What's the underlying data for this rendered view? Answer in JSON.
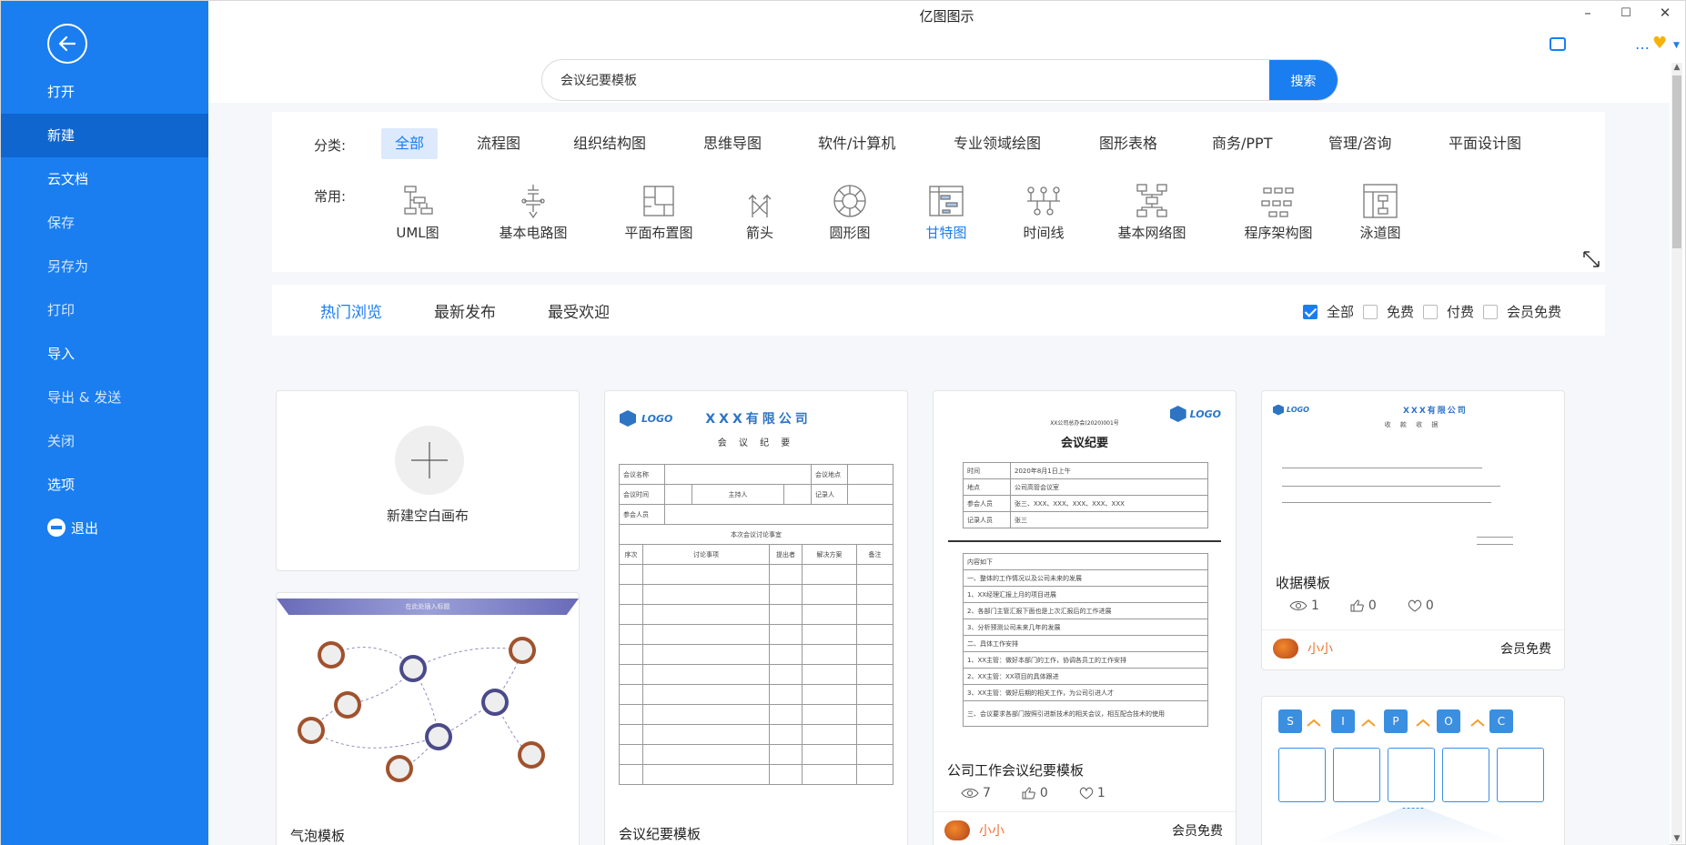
{
  "window": {
    "title": "亿图图示",
    "min": "–",
    "max": "☐",
    "close": "✕"
  },
  "sidebar": {
    "items": [
      {
        "label": "打开"
      },
      {
        "label": "新建"
      },
      {
        "label": "云文档"
      },
      {
        "label": "保存"
      },
      {
        "label": "另存为"
      },
      {
        "label": "打印"
      },
      {
        "label": "导入"
      },
      {
        "label": "导出 & 发送"
      },
      {
        "label": "关闭"
      },
      {
        "label": "选项"
      },
      {
        "label": "退出"
      }
    ]
  },
  "search": {
    "value": "会议纪要模板",
    "button": "搜索"
  },
  "categories": {
    "label": "分类:",
    "items": [
      "全部",
      "流程图",
      "组织结构图",
      "思维导图",
      "软件/计算机",
      "专业领域绘图",
      "图形表格",
      "商务/PPT",
      "管理/咨询",
      "平面设计图"
    ]
  },
  "common": {
    "label": "常用:",
    "items": [
      "UML图",
      "基本电路图",
      "平面布置图",
      "箭头",
      "圆形图",
      "甘特图",
      "时间线",
      "基本网络图",
      "程序架构图",
      "泳道图"
    ]
  },
  "tabs": [
    "热门浏览",
    "最新发布",
    "最受欢迎"
  ],
  "filters": [
    "全部",
    "免费",
    "付费",
    "会员免费"
  ],
  "cards": {
    "new_blank": {
      "title": "新建空白画布"
    },
    "bubble": {
      "title": "气泡模板",
      "banner": "在此处插入标题"
    },
    "meeting": {
      "title": "会议纪要模板",
      "logo": "LOGO",
      "company": "XXX有限公司",
      "doc_title": "会 议 纪 要",
      "rows": [
        "会议名称",
        "会议时间",
        "参会人员"
      ],
      "right_rows": [
        "会议地点",
        "记录人"
      ],
      "host": "主持人",
      "section": "本次会议讨论事宜",
      "cols": [
        "序次",
        "讨论事项",
        "提出者",
        "解决方案",
        "备注"
      ]
    },
    "company_meeting": {
      "title": "公司工作会议纪要模板",
      "logo": "LOGO",
      "doc_no": "XX公司总办会(2020)001号",
      "doc_title": "会议纪要",
      "info": [
        [
          "时间",
          "2020年8月1日上午"
        ],
        [
          "地点",
          "公司高管会议室"
        ],
        [
          "参会人员",
          "张三、XXX、XXX、XXX、XXX、XXX"
        ],
        [
          "记录人员",
          "张三"
        ]
      ],
      "content_head": "内容如下",
      "content": [
        "一、整体的工作情况以及公司未来的发展",
        "1、XX经理汇报上月的项目进展",
        "2、各部门主管汇报下面也是上次汇报后的工作进展",
        "3、分析预测公司未来几年的发展",
        "二、具体工作安排",
        "1、XX主管：做好本部门的工作，协调各员工的工作安排",
        "2、XX主管：XX项目的具体跟进",
        "3、XX主管：做好后期的相关工作，为公司引进人才",
        "三、会议要求各部门按照引进新技术的相关会议，相互配合技术的使用"
      ],
      "views": "7",
      "likes": "0",
      "favs": "1",
      "author": "小小",
      "price": "会员免费"
    },
    "receipt": {
      "title": "收据模板",
      "logo": "LOGO",
      "company": "XXX有限公司",
      "doc_title": "收 款 收 据",
      "views": "1",
      "likes": "0",
      "favs": "0",
      "author": "小小",
      "price": "会员免费"
    },
    "sipoc": {
      "letters": [
        "S",
        "I",
        "P",
        "O",
        "C"
      ]
    }
  }
}
